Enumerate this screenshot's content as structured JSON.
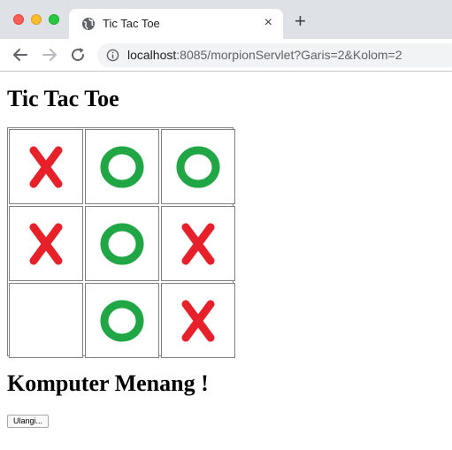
{
  "browser": {
    "tab_title": "Tic Tac Toe",
    "tab_close": "×",
    "new_tab": "+",
    "url_host": "localhost",
    "url_rest": ":8085/morpionServlet?Garis=2&Kolom=2",
    "icons": {
      "favicon": "globe-icon",
      "back": "arrow-left-icon",
      "forward": "arrow-right-icon",
      "reload": "reload-icon",
      "info": "info-icon",
      "close": "close-icon"
    }
  },
  "page": {
    "title": "Tic Tac Toe",
    "result": "Komputer Menang !",
    "replay_label": "Ulangi..."
  },
  "board": {
    "cells": [
      [
        "X",
        "O",
        "O"
      ],
      [
        "X",
        "O",
        "X"
      ],
      [
        "",
        "O",
        "X"
      ]
    ],
    "x_color": "#e8202a",
    "o_color": "#21a645"
  }
}
